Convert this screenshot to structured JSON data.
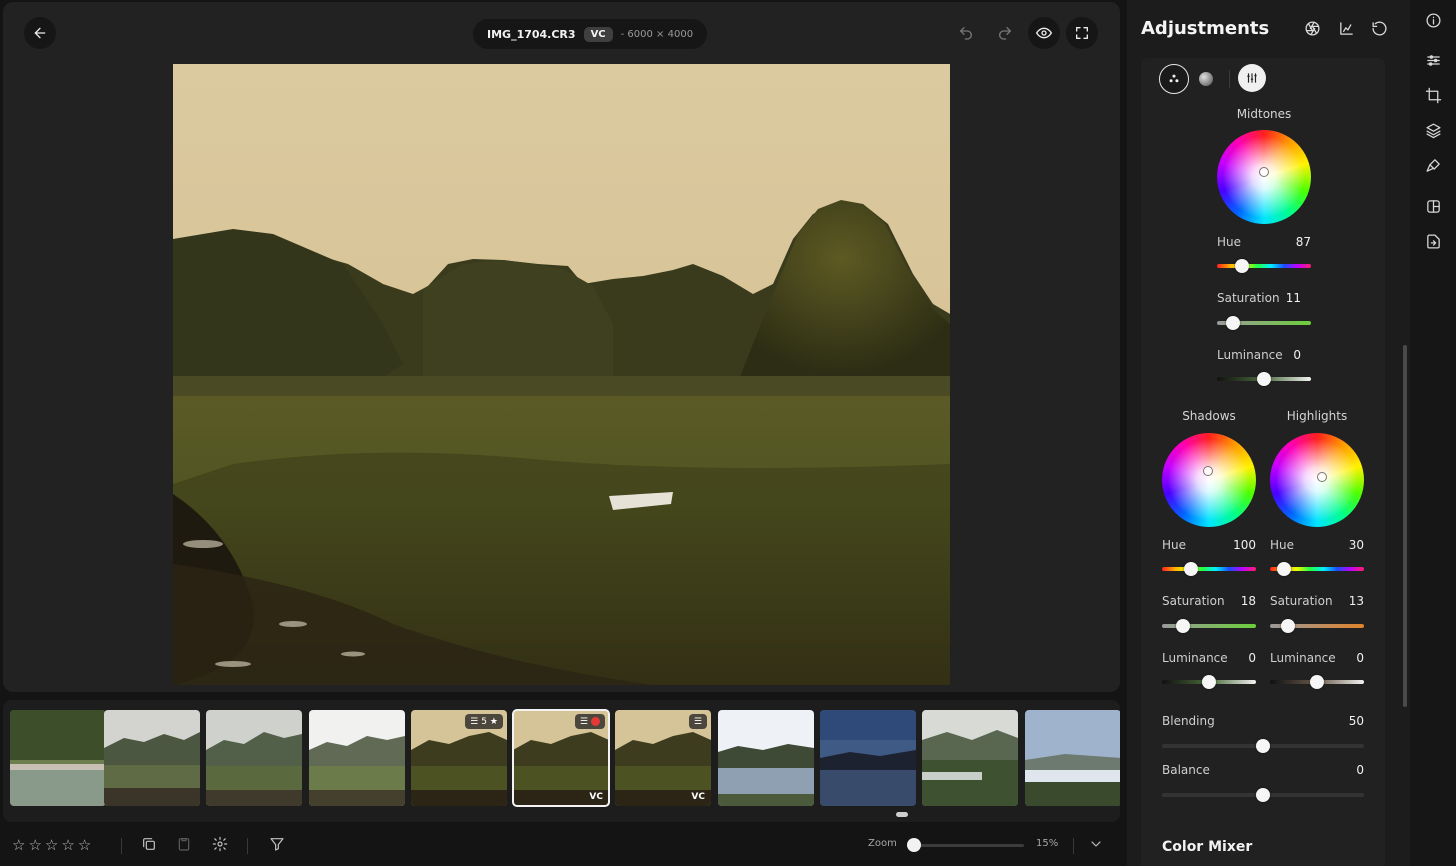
{
  "header": {
    "file_name": "IMG_1704.CR3",
    "badge": "VC",
    "dimensions": "- 6000 × 4000"
  },
  "icons": {
    "back": "arrow-left-icon",
    "undo": "undo-icon",
    "redo": "redo-icon",
    "preview": "eye-icon",
    "fullscreen": "fullscreen-icon"
  },
  "filmstrip": {
    "thumbs": [
      {
        "scene": "river-boats"
      },
      {
        "scene": "muddy-field"
      },
      {
        "scene": "field-overcast"
      },
      {
        "scene": "field-bright"
      },
      {
        "scene": "field-warm",
        "badge_rating": "5",
        "has_edit_icon": true
      },
      {
        "scene": "field-warm",
        "selected": true,
        "has_edit_icon": true,
        "red_label": true,
        "vc": "VC"
      },
      {
        "scene": "field-warm",
        "has_edit_icon": true,
        "vc": "VC"
      },
      {
        "scene": "lake-reflection"
      },
      {
        "scene": "dusk-lake"
      },
      {
        "scene": "valley-green"
      },
      {
        "scene": "sunset-water"
      }
    ]
  },
  "bottombar": {
    "rating_stars": 5,
    "zoom_label": "Zoom",
    "zoom_value": "15%",
    "zoom_fraction": 0.0
  },
  "adjustments": {
    "title": "Adjustments",
    "midtones": {
      "label": "Midtones",
      "hue_label": "Hue",
      "hue_value": "87",
      "hue_fraction": 0.27,
      "sat_label": "Saturation",
      "sat_value": "11",
      "sat_fraction": 0.17,
      "lum_label": "Luminance",
      "lum_value": "0",
      "lum_fraction": 0.5
    },
    "shadows": {
      "label": "Shadows",
      "hue_label": "Hue",
      "hue_value": "100",
      "hue_fraction": 0.31,
      "sat_label": "Saturation",
      "sat_value": "18",
      "sat_fraction": 0.22,
      "lum_label": "Luminance",
      "lum_value": "0",
      "lum_fraction": 0.5
    },
    "highlights": {
      "label": "Highlights",
      "hue_label": "Hue",
      "hue_value": "30",
      "hue_fraction": 0.15,
      "sat_label": "Saturation",
      "sat_value": "13",
      "sat_fraction": 0.19,
      "lum_label": "Luminance",
      "lum_value": "0",
      "lum_fraction": 0.5
    },
    "blending_label": "Blending",
    "blending_value": "50",
    "blending_fraction": 0.5,
    "balance_label": "Balance",
    "balance_value": "0",
    "balance_fraction": 0.5,
    "next_section": "Color Mixer"
  },
  "colors": {
    "accent_white": "#f2f2f2",
    "red_label": "#e53935",
    "sat_green": "#6ccf3a",
    "sat_orange": "#e0832a"
  }
}
